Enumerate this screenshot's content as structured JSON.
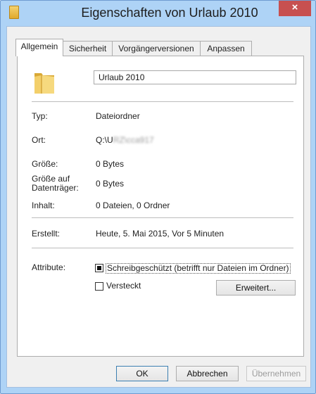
{
  "window": {
    "title": "Eigenschaften von Urlaub 2010",
    "close_glyph": "×"
  },
  "tabs": [
    {
      "label": "Allgemein",
      "active": true
    },
    {
      "label": "Sicherheit",
      "active": false
    },
    {
      "label": "Vorgängerversionen",
      "active": false
    },
    {
      "label": "Anpassen",
      "active": false
    }
  ],
  "general": {
    "folder_icon": "folder-icon",
    "name_value": "Urlaub 2010",
    "type_label": "Typ:",
    "type_value": "Dateiordner",
    "location_label": "Ort:",
    "location_value_prefix": "Q:\\U",
    "location_value_obscured": "RZ\\cca917",
    "size_label": "Größe:",
    "size_value": "0 Bytes",
    "size_on_disk_label_line1": "Größe auf",
    "size_on_disk_label_line2": "Datenträger:",
    "size_on_disk_value": "0 Bytes",
    "contents_label": "Inhalt:",
    "contents_value": "0 Dateien, 0 Ordner",
    "created_label": "Erstellt:",
    "created_value": "Heute, 5. Mai 2015, Vor 5 Minuten",
    "attributes_label": "Attribute:",
    "readonly_label": "Schreibgeschützt (betrifft nur Dateien im Ordner)",
    "readonly_state": "indeterminate",
    "hidden_label": "Versteckt",
    "hidden_checked": false,
    "advanced_button": "Erweitert..."
  },
  "buttons": {
    "ok": "OK",
    "cancel": "Abbrechen",
    "apply": "Übernehmen"
  },
  "colors": {
    "frame": "#aed3f6",
    "close": "#c75050",
    "panel": "#ffffff",
    "dialog": "#f0f0f0"
  }
}
